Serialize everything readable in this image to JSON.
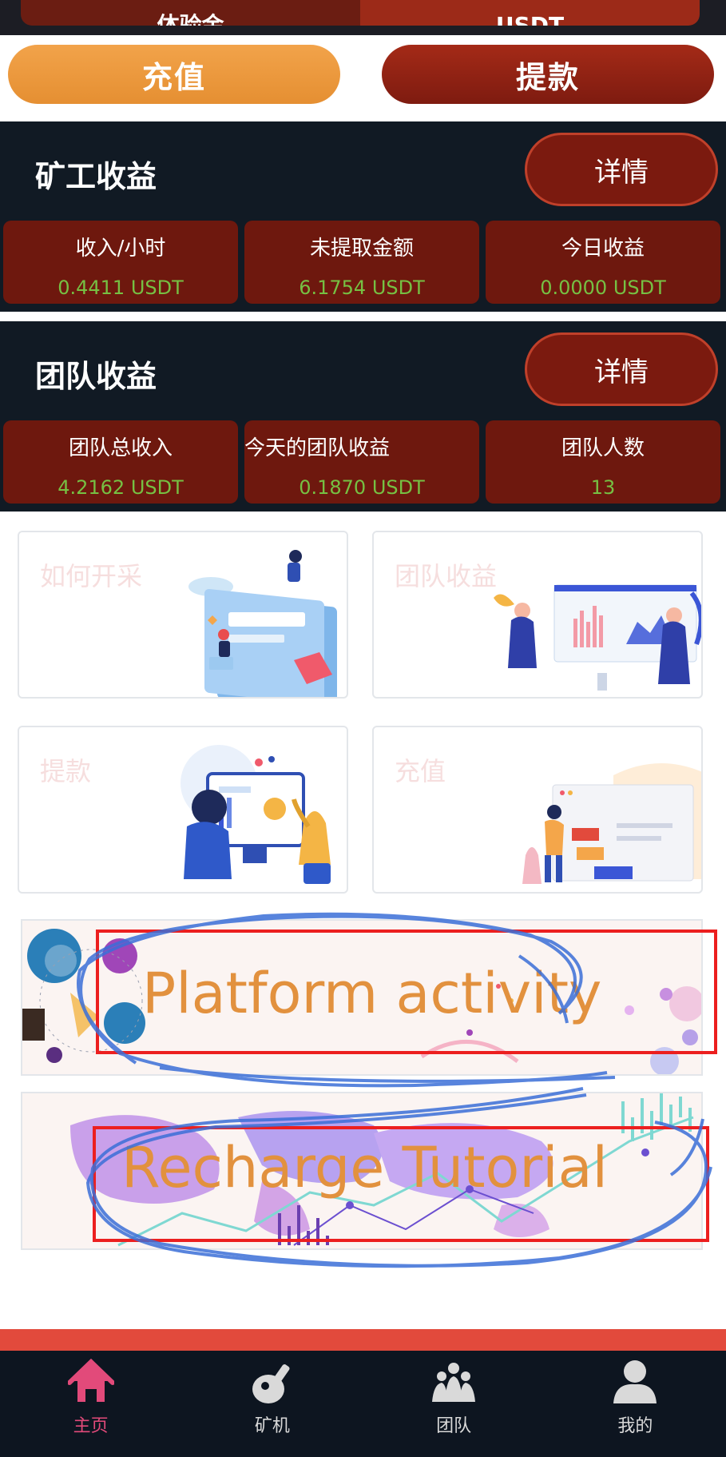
{
  "top_tabs": [
    "体验金",
    "USDT"
  ],
  "actions": {
    "recharge": "充值",
    "withdraw": "提款"
  },
  "miner_earnings": {
    "title": "矿工收益",
    "detail_label": "详情",
    "stats": [
      {
        "label": "收入/小时",
        "value": "0.4411  USDT"
      },
      {
        "label": "未提取金额",
        "value": "6.1754  USDT"
      },
      {
        "label": "今日收益",
        "value": "0.0000  USDT"
      }
    ]
  },
  "team_earnings": {
    "title": "团队收益",
    "detail_label": "详情",
    "stats": [
      {
        "label": "团队总收入",
        "value": "4.2162  USDT"
      },
      {
        "label": "今天的团队收益",
        "value": "0.1870  USDT"
      },
      {
        "label": "团队人数",
        "value": "13"
      }
    ]
  },
  "cards": [
    {
      "label": "如何开采"
    },
    {
      "label": "团队收益"
    },
    {
      "label": "提款"
    },
    {
      "label": "充值"
    }
  ],
  "banners": [
    {
      "text": "Platform activity"
    },
    {
      "text": "Recharge Tutorial"
    }
  ],
  "nav": [
    {
      "label": "主页",
      "icon": "home-icon",
      "active": true
    },
    {
      "label": "矿机",
      "icon": "mining-machine-icon",
      "active": false
    },
    {
      "label": "团队",
      "icon": "team-icon",
      "active": false
    },
    {
      "label": "我的",
      "icon": "profile-icon",
      "active": false
    }
  ],
  "colors": {
    "accent_orange": "#e58f32",
    "accent_red": "#7e1b10",
    "value_green": "#76c043",
    "panel_dark": "#111a24",
    "nav_active": "#e24a7a",
    "annotation_red": "#ec1f1f",
    "annotation_blue": "#3b6fd8"
  }
}
